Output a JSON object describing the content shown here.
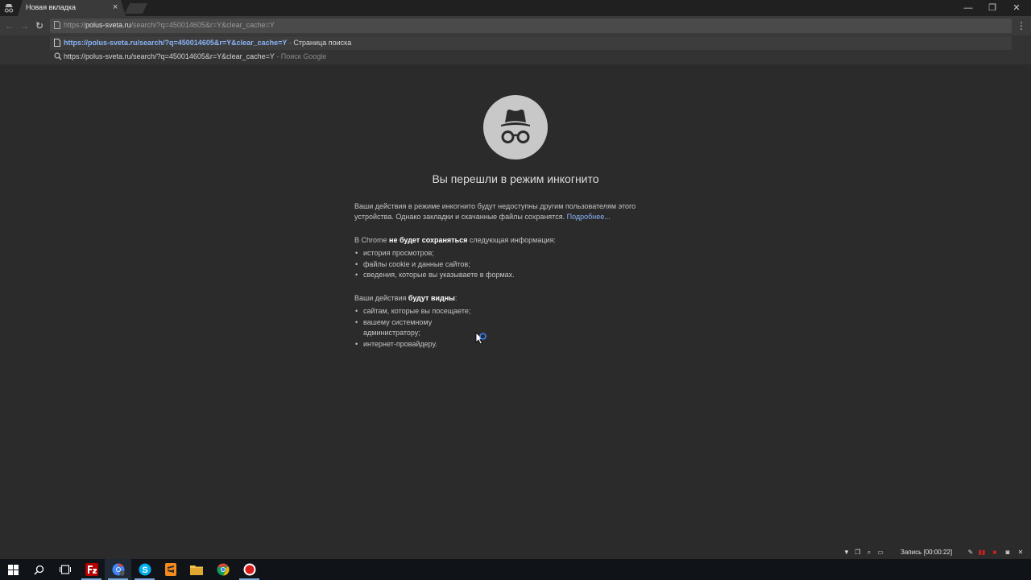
{
  "browser": {
    "tab": {
      "title": "Новая вкладка",
      "close": "×"
    },
    "window_controls": {
      "minimize": "—",
      "restore": "❐",
      "close": "✕"
    },
    "nav": {
      "back": "←",
      "forward": "→",
      "reload": "↻"
    },
    "omnibox": {
      "prefix": "https://",
      "host": "polus-sveta.ru",
      "path": "/search/?q=450014605&r=Y&clear_cache=Y"
    },
    "menu": "⋮"
  },
  "suggestions": [
    {
      "text": "https://polus-sveta.ru/search/?q=450014605&r=Y&clear_cache=Y",
      "separator": " - ",
      "desc": "Страница поиска",
      "icon": "page-icon"
    },
    {
      "text": "https://polus-sveta.ru/search/?q=450014605&r=Y&clear_cache=Y",
      "separator": " - ",
      "desc": "Поиск Google",
      "icon": "search-icon"
    }
  ],
  "incognito": {
    "icon": "incognito-icon",
    "title": "Вы перешли в режим инкогнито",
    "intro_line1": "Ваши действия в режиме инкогнито будут недоступны другим пользователям этого",
    "intro_line2": "устройства. Однако закладки и скачанные файлы сохранятся.",
    "learn_more": "Подробнее...",
    "not_saved_pre": "В Chrome",
    "not_saved_bold": "не будет сохраняться",
    "not_saved_post": "следующая информация:",
    "not_saved_items": [
      "история просмотров;",
      "файлы cookie и данные сайтов;",
      "сведения, которые вы указываете в формах."
    ],
    "visible_pre": "Ваши действия",
    "visible_bold": "будут видны",
    "visible_post": ":",
    "visible_items": [
      "сайтам, которые вы посещаете;",
      "вашему системному",
      "администратору;",
      "интернет-провайдеру."
    ]
  },
  "recorder": {
    "label": "Запись [00:00:22]",
    "close": "✕"
  },
  "taskbar": {
    "apps": [
      "start-icon",
      "search-icon",
      "task-view-icon",
      "filezilla-icon",
      "chrome-incognito-icon",
      "skype-icon",
      "sublime-icon",
      "file-explorer-icon",
      "chrome-icon",
      "recorder-icon"
    ]
  },
  "colors": {
    "page_bg": "#2b2b2b",
    "link": "#8ab4f8",
    "taskbar": "#101318"
  }
}
